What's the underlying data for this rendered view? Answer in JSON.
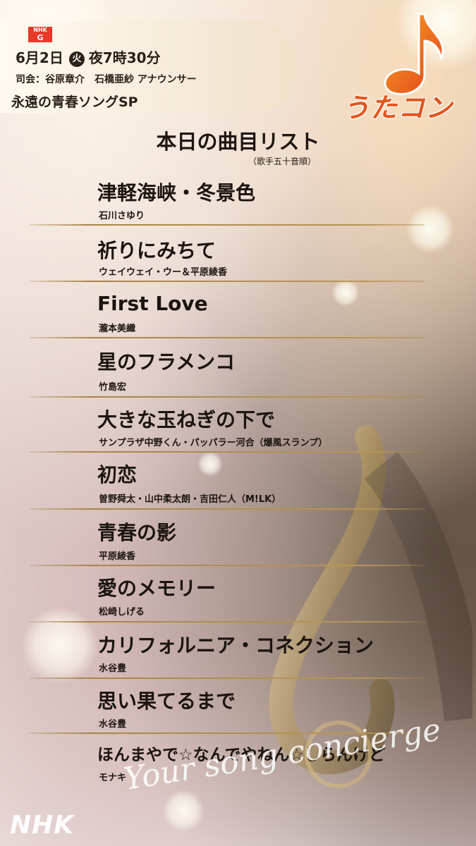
{
  "header": {
    "channel_top": "NHK",
    "channel_bottom": "G",
    "date": "6月2日",
    "day_of_week": "火",
    "time": "夜7時30分",
    "hosts": "司会：谷原章介　石橋亜紗 アナウンサー",
    "special_title": "永遠の青春ソングSP"
  },
  "logo": {
    "text": "うたコン",
    "brand_color": "#E3561D",
    "icon": "music-note-icon"
  },
  "list": {
    "title": "本日の曲目リスト",
    "subtitle": "（歌手五十音順）",
    "songs": [
      {
        "title": "津軽海峡・冬景色",
        "artist": "石川さゆり"
      },
      {
        "title": "祈りにみちて",
        "artist": "ウェイウェイ・ウー＆平原綾香"
      },
      {
        "title": "First Love",
        "artist": "瀧本美織"
      },
      {
        "title": "星のフラメンコ",
        "artist": "竹島宏"
      },
      {
        "title": "大きな玉ねぎの下で",
        "artist": "サンプラザ中野くん・パッパラー河合（爆風スランプ）"
      },
      {
        "title": "初恋",
        "artist": "曽野舜太・山中柔太朗・吉田仁人（M!LK）"
      },
      {
        "title": "青春の影",
        "artist": "平原綾香"
      },
      {
        "title": "愛のメモリー",
        "artist": "松崎しげる"
      },
      {
        "title": "カリフォルニア・コネクション",
        "artist": "水谷豊"
      },
      {
        "title": "思い果てるまで",
        "artist": "水谷豊"
      },
      {
        "title": "ほんまやで☆なんでやねん☆しらんけど",
        "artist": "モナキ"
      }
    ]
  },
  "footer": {
    "broadcaster": "NHK",
    "tagline": "Your song concierge"
  }
}
